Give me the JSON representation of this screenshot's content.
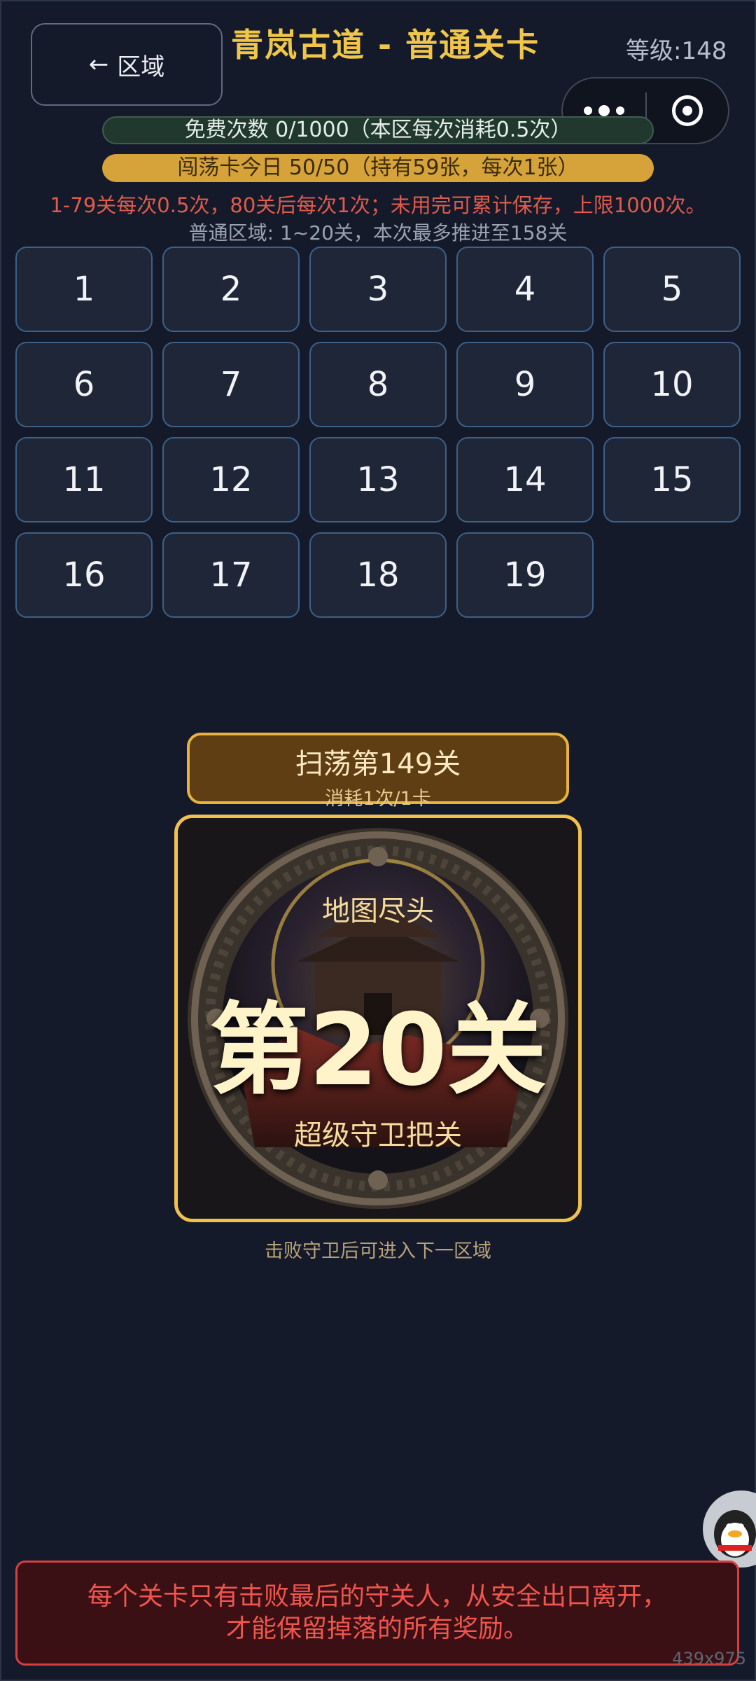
{
  "header": {
    "back_label": "区域",
    "back_arrow": "←",
    "title": "青岚古道 - 普通关卡",
    "level": "等级:148"
  },
  "status": {
    "free_counts": "免费次数 0/1000（本区每次消耗0.5次）",
    "sweep_cards": "闯荡卡今日 50/50（持有59张，每次1张）",
    "rule_note": "1-79关每次0.5次，80关后每次1次；未用完可累计保存，上限1000次。",
    "area_note": "普通区域: 1~20关，本次最多推进至158关"
  },
  "stages": [
    "1",
    "2",
    "3",
    "4",
    "5",
    "6",
    "7",
    "8",
    "9",
    "10",
    "11",
    "12",
    "13",
    "14",
    "15",
    "16",
    "17",
    "18",
    "19"
  ],
  "sweep": {
    "title": "扫荡第149关",
    "cost": "消耗1次/1卡"
  },
  "stage_card": {
    "top": "地图尽头",
    "main": "第20关",
    "bottom": "超级守卫把关"
  },
  "hint": "击败守卫后可进入下一区域",
  "warning": {
    "line1": "每个关卡只有击败最后的守关人，从安全出口离开，",
    "line2": "才能保留掉落的所有奖励。"
  },
  "size_label": "439x975",
  "colors": {
    "background": "#141a29",
    "title_gold": "#f0c64a",
    "stage_border": "#3e5f86",
    "warning_red": "#f0554e"
  }
}
